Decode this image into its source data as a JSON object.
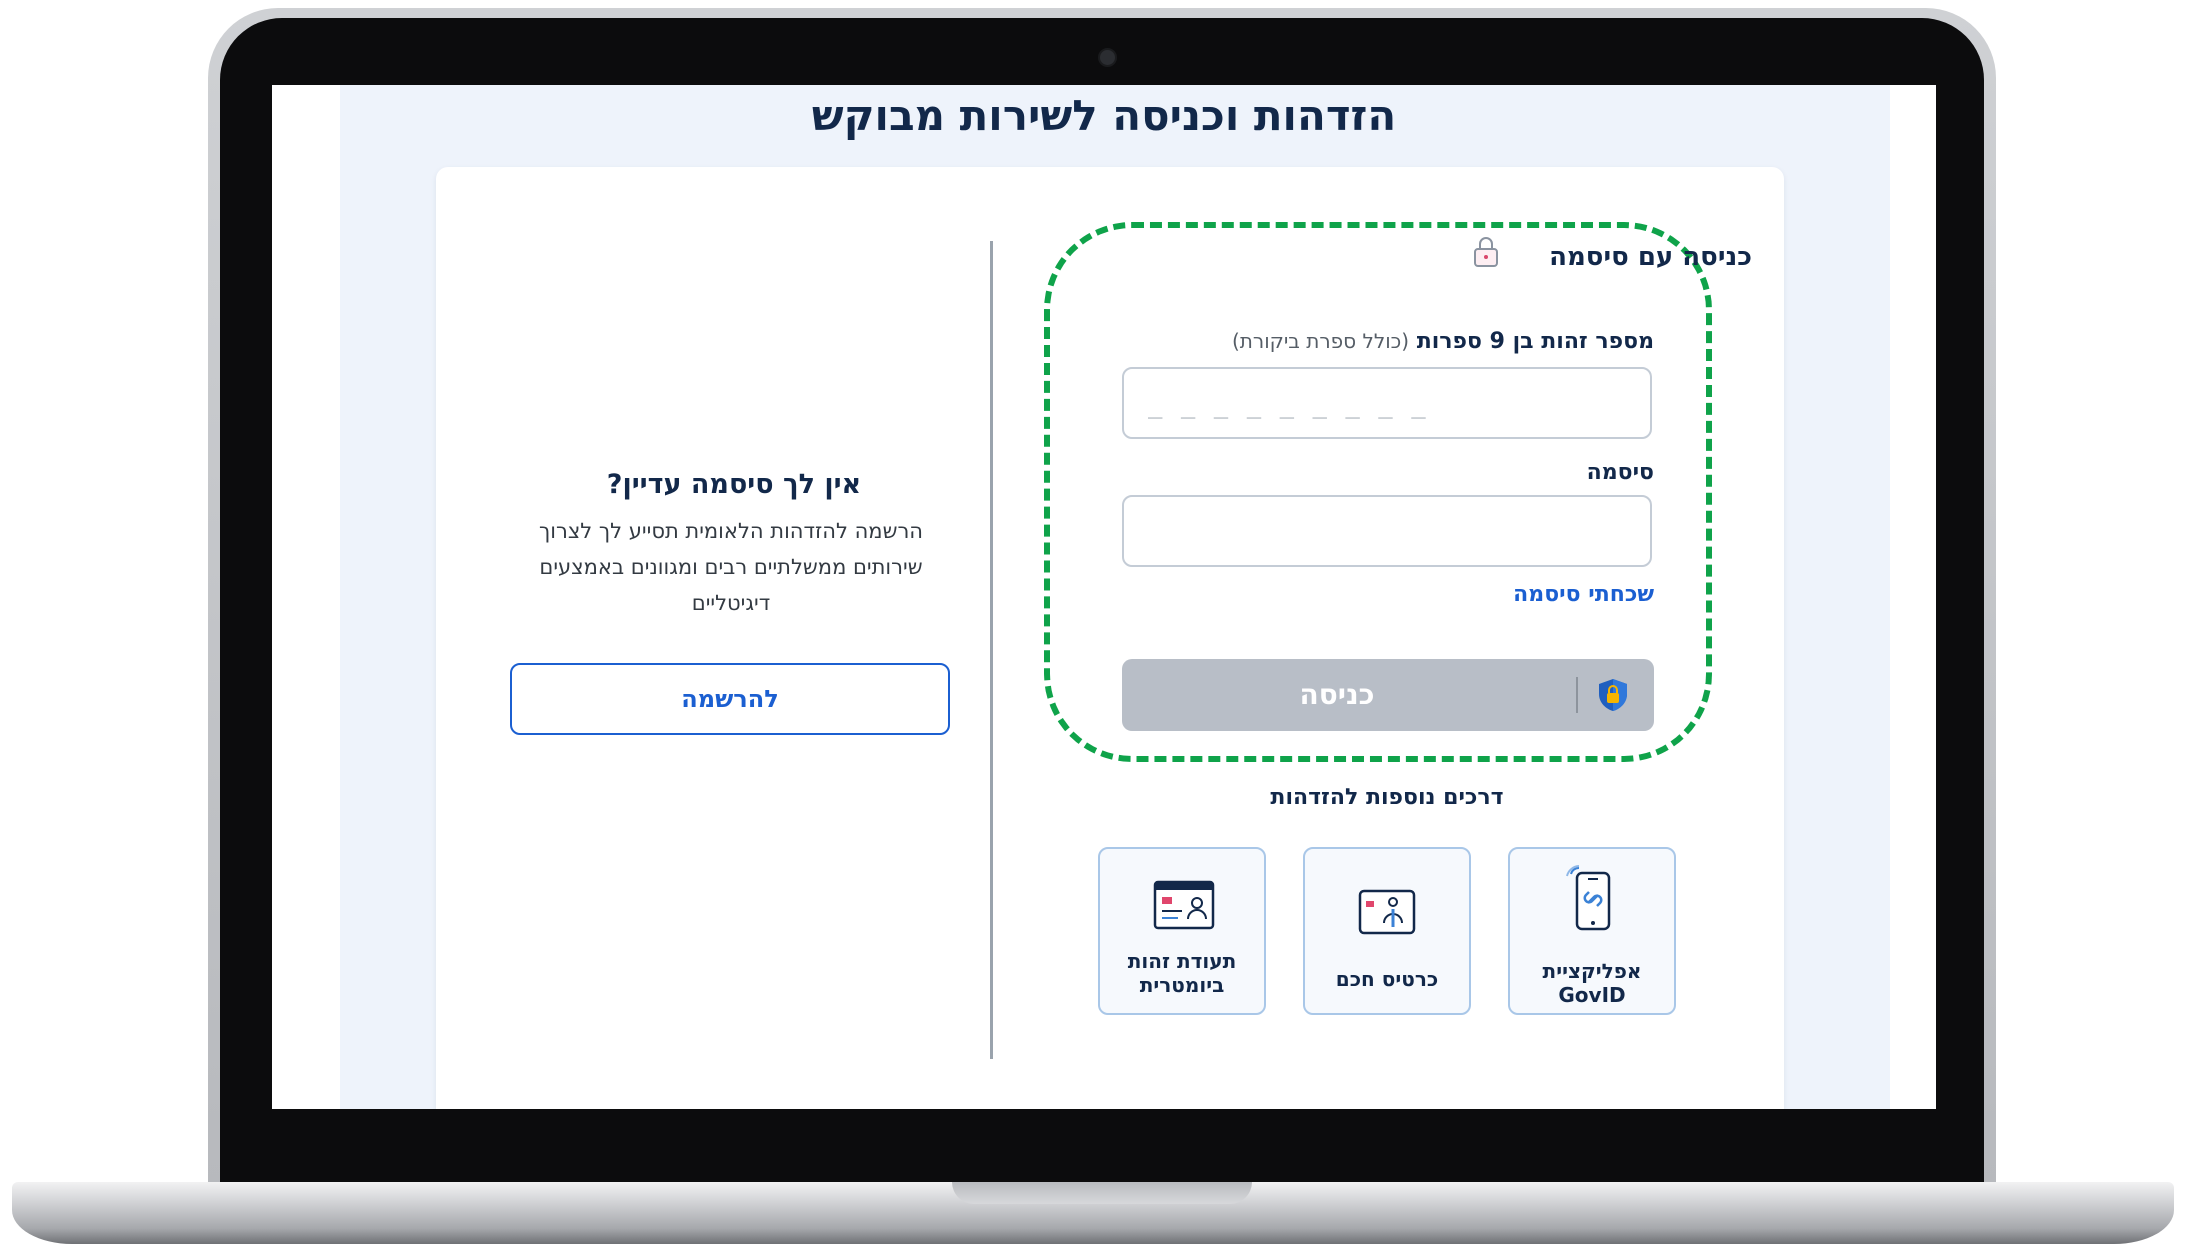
{
  "page": {
    "title": "הזדהות וכניסה לשירות מבוקש"
  },
  "login": {
    "title": "כניסה עם סיסמה",
    "id_label_bold": "מספר זהות בן 9 ספרות",
    "id_label_hint": "(כולל ספרת ביקורת)",
    "id_placeholder": "_ _ _ _ _ _ _ _ _",
    "password_label": "סיסמה",
    "forgot_password": "שכחתי סיסמה",
    "submit_label": "כניסה"
  },
  "other_methods": {
    "title": "דרכים נוספות להזדהות",
    "items": [
      {
        "label": "אפליקציית GovID",
        "icon": "phone-link-icon"
      },
      {
        "label": "כרטיס חכם",
        "icon": "smart-card-icon"
      },
      {
        "label": "תעודת זהות ביומטרית",
        "icon": "id-card-icon"
      }
    ]
  },
  "registration": {
    "title": "אין לך סיסמה עדיין?",
    "text": "הרשמה להזדהות הלאומית תסייע לך לצרוך שירותים ממשלתיים רבים ומגוונים באמצעים דיגיטליים",
    "button_label": "להרשמה"
  },
  "colors": {
    "primary": "#1b5fd1",
    "navy": "#12284a",
    "highlight": "#0fa34a",
    "disabled_button": "#b8bec7",
    "page_bg": "#eef3fb"
  }
}
